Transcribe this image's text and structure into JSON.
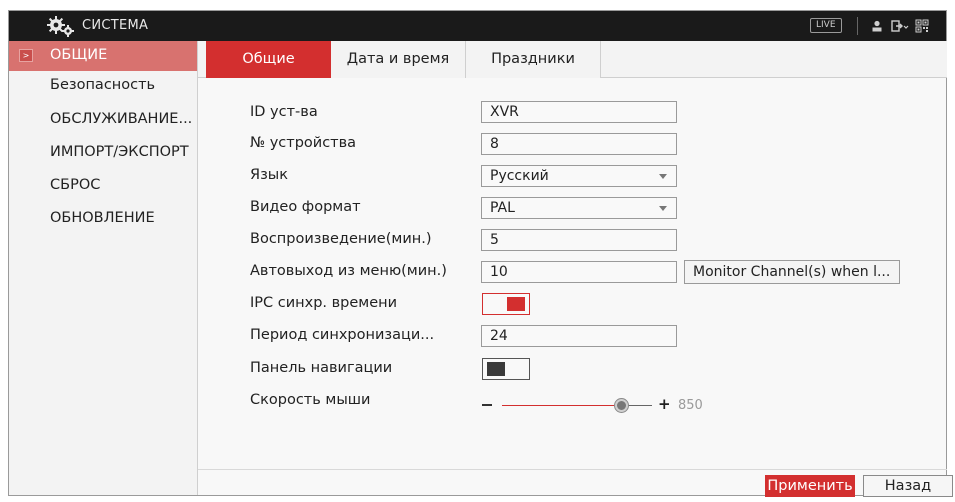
{
  "window": {
    "title": "СИСТЕМА",
    "live_label": "LIVE",
    "icons": [
      "settings-gears-icon",
      "user-icon",
      "logout-icon",
      "qr-code-icon"
    ]
  },
  "sidebar": {
    "items": [
      {
        "label": "ОБЩИЕ",
        "active": true
      },
      {
        "label": "Безопасность",
        "active": false
      },
      {
        "label": "ОБСЛУЖИВАНИЕ...",
        "active": false
      },
      {
        "label": "ИМПОРТ/ЭКСПОРТ",
        "active": false
      },
      {
        "label": "СБРОС",
        "active": false
      },
      {
        "label": "ОБНОВЛЕНИЕ",
        "active": false
      }
    ]
  },
  "tabs": [
    {
      "label": "Общие",
      "active": true
    },
    {
      "label": "Дата и время",
      "active": false
    },
    {
      "label": "Праздники",
      "active": false
    }
  ],
  "form": {
    "device_id": {
      "label": "ID уст-ва",
      "value": "XVR"
    },
    "device_no": {
      "label": "№ устройства",
      "value": "8"
    },
    "language": {
      "label": "Язык",
      "value": "Русский"
    },
    "video_format": {
      "label": "Видео формат",
      "value": "PAL"
    },
    "playback": {
      "label": "Воспроизведение(мин.)",
      "value": "5"
    },
    "auto_logout": {
      "label": "Автовыход из меню(мин.)",
      "value": "10",
      "button_label": "Monitor Channel(s) when l..."
    },
    "ipc_sync": {
      "label": "IPC синхр. времени",
      "enabled": true
    },
    "sync_period": {
      "label": "Период синхронизаци...",
      "value": "24"
    },
    "nav_bar": {
      "label": "Панель навигации",
      "enabled": false
    },
    "mouse_speed": {
      "label": "Скорость мыши",
      "value": "850",
      "fraction": 0.8,
      "minus": "–",
      "plus": "+"
    }
  },
  "buttons": {
    "apply": "Применить",
    "back": "Назад"
  },
  "colors": {
    "accent": "#d32f2f",
    "sidebar_active": "#d8726f",
    "titlebar": "#1a1a1a"
  }
}
